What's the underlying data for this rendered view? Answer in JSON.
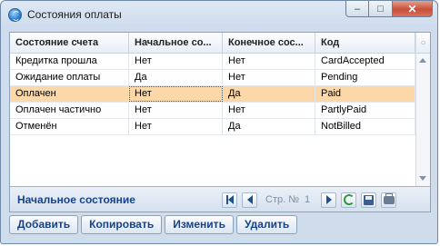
{
  "window": {
    "title": "Состояния оплаты",
    "controls": {
      "minimize": "–",
      "maximize": "□",
      "close": "✕"
    }
  },
  "grid": {
    "columns": [
      "Состояние счета",
      "Начальное со...",
      "Конечное сос...",
      "Код"
    ],
    "rows": [
      [
        "Кредитка прошла",
        "Нет",
        "Нет",
        "CardAccepted"
      ],
      [
        "Ожидание оплаты",
        "Да",
        "Нет",
        "Pending"
      ],
      [
        "Оплачен",
        "Нет",
        "Да",
        "Paid"
      ],
      [
        "Оплачен частично",
        "Нет",
        "Нет",
        "PartlyPaid"
      ],
      [
        "Отменён",
        "Нет",
        "Да",
        "NotBilled"
      ]
    ],
    "selected_row": 2,
    "selected_color": "#fcd8a8"
  },
  "footer": {
    "label": "Начальное состояние",
    "page_label": "Стр. №",
    "page_number": "1"
  },
  "buttons": {
    "add": "Добавить",
    "copy": "Копировать",
    "edit": "Изменить",
    "delete": "Удалить"
  },
  "accent_color": "#15428b"
}
